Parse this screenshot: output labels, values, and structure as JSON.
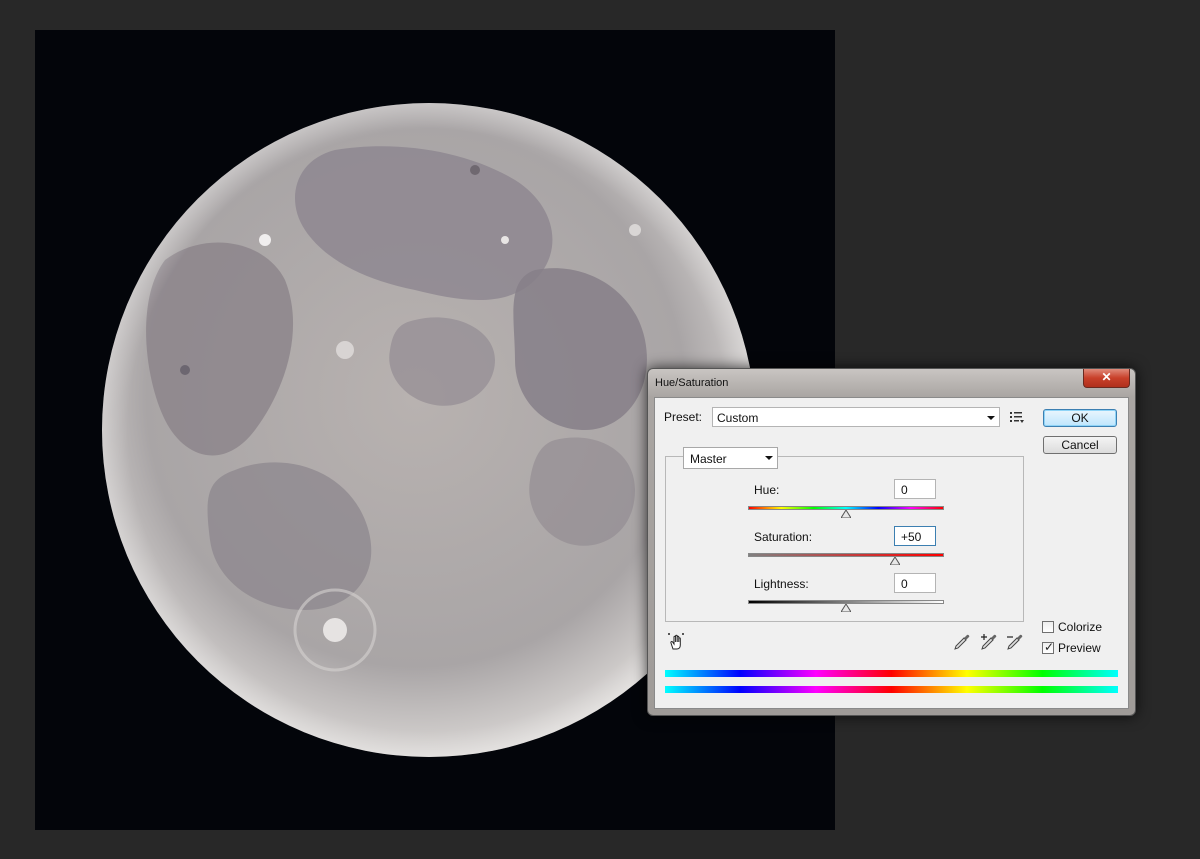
{
  "dialog": {
    "title": "Hue/Saturation",
    "close_label": "✕"
  },
  "preset": {
    "label": "Preset:",
    "value": "Custom"
  },
  "buttons": {
    "ok": "OK",
    "cancel": "Cancel"
  },
  "channel": {
    "value": "Master"
  },
  "sliders": {
    "hue": {
      "label": "Hue:",
      "value": "0",
      "level": 0.5
    },
    "saturation": {
      "label": "Saturation:",
      "value": "+50",
      "level": 0.75
    },
    "lightness": {
      "label": "Lightness:",
      "value": "0",
      "level": 0.5
    }
  },
  "options": {
    "colorize": {
      "label": "Colorize",
      "checked": false
    },
    "preview": {
      "label": "Preview",
      "checked": true
    }
  },
  "icons": {
    "preset_menu": "preset-options-icon",
    "target_tool": "targeted-adjustment-hand-icon",
    "eyedropper": "eyedropper-icon",
    "eyedropper_add": "eyedropper-plus-icon",
    "eyedropper_subtract": "eyedropper-minus-icon"
  },
  "colors": {
    "canvas_background": "#282828",
    "image_background": "#03050a",
    "default_button_border": "#3c7fb1"
  }
}
